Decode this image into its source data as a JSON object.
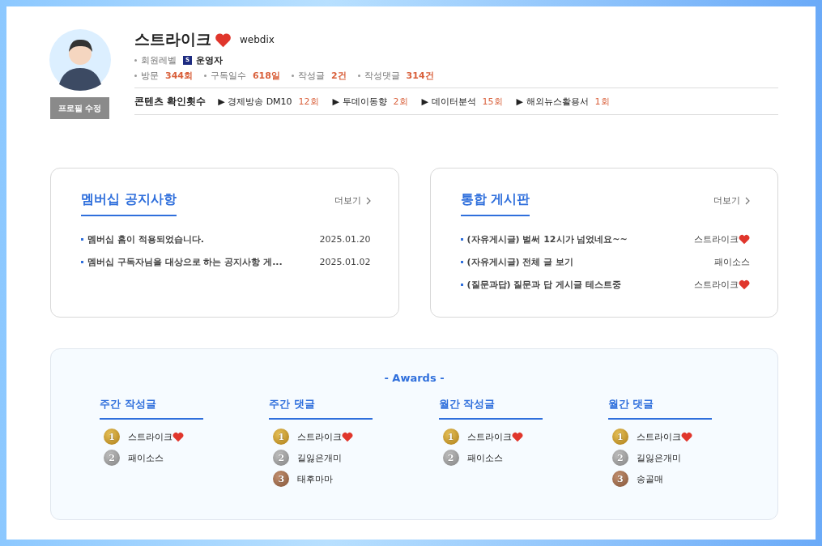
{
  "profile": {
    "name": "스트라이크",
    "heart": true,
    "user_id": "webdix",
    "edit_button": "프로필 수정",
    "level_label": "회원레벨",
    "level_badge": "S",
    "level_name": "운영자",
    "stats": [
      {
        "label": "방문",
        "value": "344회"
      },
      {
        "label": "구독일수",
        "value": "618일"
      },
      {
        "label": "작성글",
        "value": "2건"
      },
      {
        "label": "작성댓글",
        "value": "314건"
      }
    ],
    "contents_label": "콘텐츠 확인횟수",
    "contents": [
      {
        "marker": "▶",
        "label": "경제방송 DM10",
        "value": "12회"
      },
      {
        "marker": "▶",
        "label": "투데이동향",
        "value": "2회"
      },
      {
        "marker": "▶",
        "label": "데이터분석",
        "value": "15회"
      },
      {
        "marker": "▶",
        "label": "해외뉴스활용서",
        "value": "1회"
      }
    ]
  },
  "boards": [
    {
      "title": "멤버십 공지사항",
      "more": "더보기",
      "posts": [
        {
          "title": "멤버십 홈이 적용되었습니다.",
          "meta": "2025.01.20",
          "heart": false
        },
        {
          "title": "멤버십 구독자님을 대상으로 하는 공지사항 게...",
          "meta": "2025.01.02",
          "heart": false
        }
      ]
    },
    {
      "title": "통합 게시판",
      "more": "더보기",
      "posts": [
        {
          "title": "(자유게시글) 벌써 12시가 넘었네요~~",
          "meta": "스트라이크",
          "heart": true
        },
        {
          "title": "(자유게시글) 전체 글 보기",
          "meta": "패이소스",
          "heart": false
        },
        {
          "title": "(질문과답) 질문과 답 게시글 테스트중",
          "meta": "스트라이크",
          "heart": true
        }
      ]
    }
  ],
  "awards": {
    "title": "- Awards -",
    "groups": [
      {
        "title": "주간 작성글",
        "entries": [
          {
            "rank": "1",
            "kind": "gold",
            "name": "스트라이크",
            "heart": true
          },
          {
            "rank": "2",
            "kind": "silver",
            "name": "패이소스",
            "heart": false
          }
        ]
      },
      {
        "title": "주간 댓글",
        "entries": [
          {
            "rank": "1",
            "kind": "gold",
            "name": "스트라이크",
            "heart": true
          },
          {
            "rank": "2",
            "kind": "silver",
            "name": "길잃은개미",
            "heart": false
          },
          {
            "rank": "3",
            "kind": "bronze",
            "name": "태후마마",
            "heart": false
          }
        ]
      },
      {
        "title": "월간 작성글",
        "entries": [
          {
            "rank": "1",
            "kind": "gold",
            "name": "스트라이크",
            "heart": true
          },
          {
            "rank": "2",
            "kind": "silver",
            "name": "패이소스",
            "heart": false
          }
        ]
      },
      {
        "title": "월간 댓글",
        "entries": [
          {
            "rank": "1",
            "kind": "gold",
            "name": "스트라이크",
            "heart": true
          },
          {
            "rank": "2",
            "kind": "silver",
            "name": "길잃은개미",
            "heart": false
          },
          {
            "rank": "3",
            "kind": "bronze",
            "name": "송골매",
            "heart": false
          }
        ]
      }
    ]
  }
}
